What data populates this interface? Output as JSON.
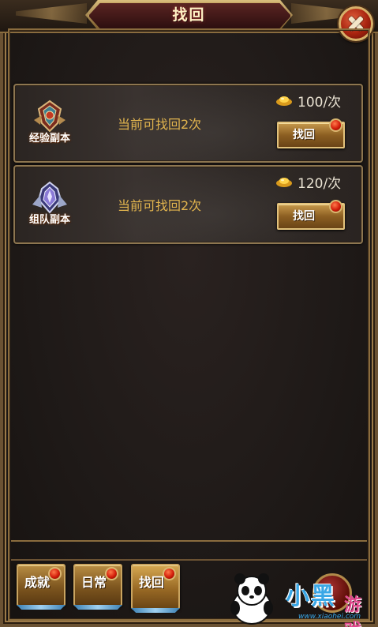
{
  "dialog": {
    "title": "找回"
  },
  "entries": [
    {
      "icon_name": "shield-emblem-icon",
      "icon_label": "经验副本",
      "description": "当前可找回2次",
      "cost_icon": "gold-ingot-icon",
      "cost": "100/次",
      "button_label": "找回",
      "has_notification_dot": true
    },
    {
      "icon_name": "crystal-emblem-icon",
      "icon_label": "组队副本",
      "description": "当前可找回2次",
      "cost_icon": "gold-ingot-icon",
      "cost": "120/次",
      "button_label": "找回",
      "has_notification_dot": true
    }
  ],
  "bottom_tabs": [
    {
      "label": "成就",
      "active": false,
      "has_notification_dot": true
    },
    {
      "label": "日常",
      "active": false,
      "has_notification_dot": true
    },
    {
      "label": "找回",
      "active": true,
      "has_notification_dot": true
    }
  ],
  "watermark": {
    "text": "小黑游戏",
    "url": "www.xiaohei.com"
  },
  "colors": {
    "frame_gold": "#8a6c3e",
    "desc_text": "#e1b44e",
    "button_gold": "#c79a4c",
    "notification_red": "#d21d0a"
  }
}
